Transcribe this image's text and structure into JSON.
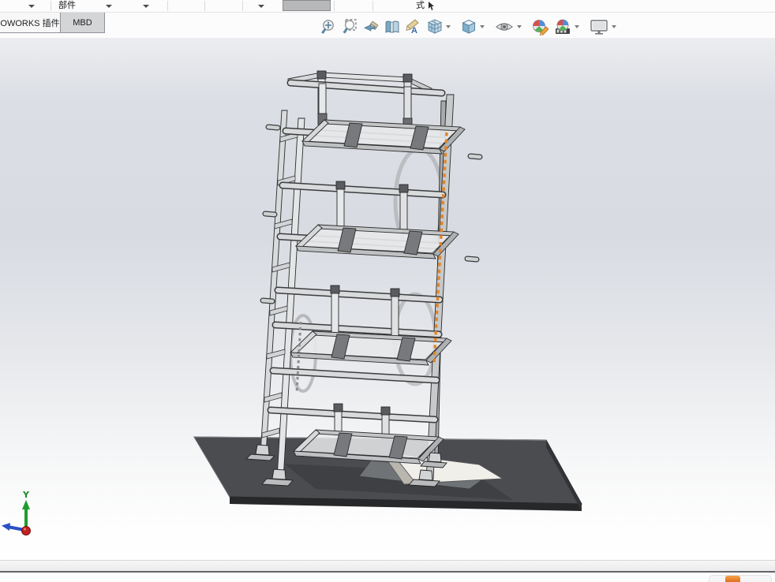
{
  "chrome": {
    "command_row": {
      "component_label": "部件",
      "style_label": "式"
    },
    "tabs": [
      {
        "label": "OWORKS 插件"
      },
      {
        "label": "MBD"
      }
    ],
    "headsup": {
      "items": [
        {
          "name": "zoom-to-fit"
        },
        {
          "name": "zoom-to-area"
        },
        {
          "name": "previous-view"
        },
        {
          "name": "section-view"
        },
        {
          "name": "annotation-view"
        },
        {
          "name": "view-orientation",
          "dropdown": true
        },
        {
          "name": "display-style",
          "dropdown": true
        },
        {
          "name": "hide-show-items",
          "dropdown": true
        },
        {
          "name": "edit-appearance"
        },
        {
          "name": "apply-scene",
          "dropdown": true
        },
        {
          "name": "view-settings",
          "dropdown": true
        }
      ]
    }
  },
  "viewport": {
    "triad": {
      "y_axis_label": "Y"
    },
    "colors": {
      "chain_accent": "#e0862c",
      "base_plate": "#4a4c4f",
      "ramp": "#f1efe9",
      "background_top": "#d8dce2",
      "background_bottom": "#ffffff",
      "triad_y": "#1f9d2c",
      "triad_x": "#2a50c8",
      "triad_z": "#c02020"
    }
  },
  "taskbar": {
    "icon": "orange-app-icon"
  }
}
